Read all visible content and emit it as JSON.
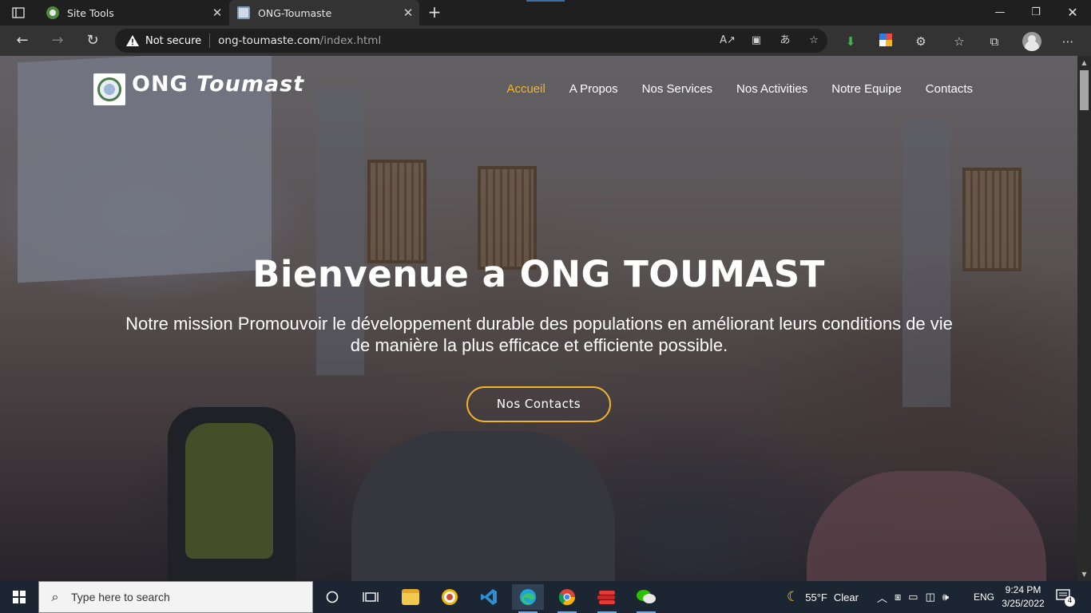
{
  "browser": {
    "tabs": [
      {
        "title": "Site Tools",
        "active": false
      },
      {
        "title": "ONG-Toumaste",
        "active": true
      }
    ],
    "address": {
      "security_label": "Not secure",
      "url_host": "ong-toumaste.com",
      "url_path": "/index.html"
    },
    "icons": {
      "back": "back-arrow-icon",
      "forward": "forward-arrow-icon",
      "reload": "reload-icon",
      "read_aloud": "read-aloud-icon",
      "immersive_reader": "immersive-reader-icon",
      "translate": "translate-icon",
      "favorite": "add-favorite-icon",
      "extensions": "extensions-icon",
      "favorites": "favorites-icon",
      "collections": "collections-icon",
      "profile": "profile-avatar",
      "menu": "more-menu-icon"
    }
  },
  "site": {
    "brand": {
      "part1": "ONG ",
      "part2": "Toumast"
    },
    "nav": [
      {
        "label": "Accueil",
        "active": true
      },
      {
        "label": "A Propos",
        "active": false
      },
      {
        "label": "Nos Services",
        "active": false
      },
      {
        "label": "Nos Activities",
        "active": false
      },
      {
        "label": "Notre Equipe",
        "active": false
      },
      {
        "label": "Contacts",
        "active": false
      }
    ],
    "hero": {
      "title": "Bienvenue a ONG TOUMAST",
      "subtitle_line1": "Notre mission Promouvoir le développement durable des populations en améliorant leurs conditions de vie",
      "subtitle_line2": "de manière la plus efficace et efficiente possible.",
      "button": "Nos Contacts"
    },
    "colors": {
      "accent": "#f0b429",
      "overlay": "#161624"
    }
  },
  "taskbar": {
    "search_placeholder": "Type here to search",
    "weather_temp": "55°F",
    "weather_text": "Clear",
    "language": "ENG",
    "time": "9:24 PM",
    "date": "3/25/2022",
    "notification_count": "4"
  }
}
